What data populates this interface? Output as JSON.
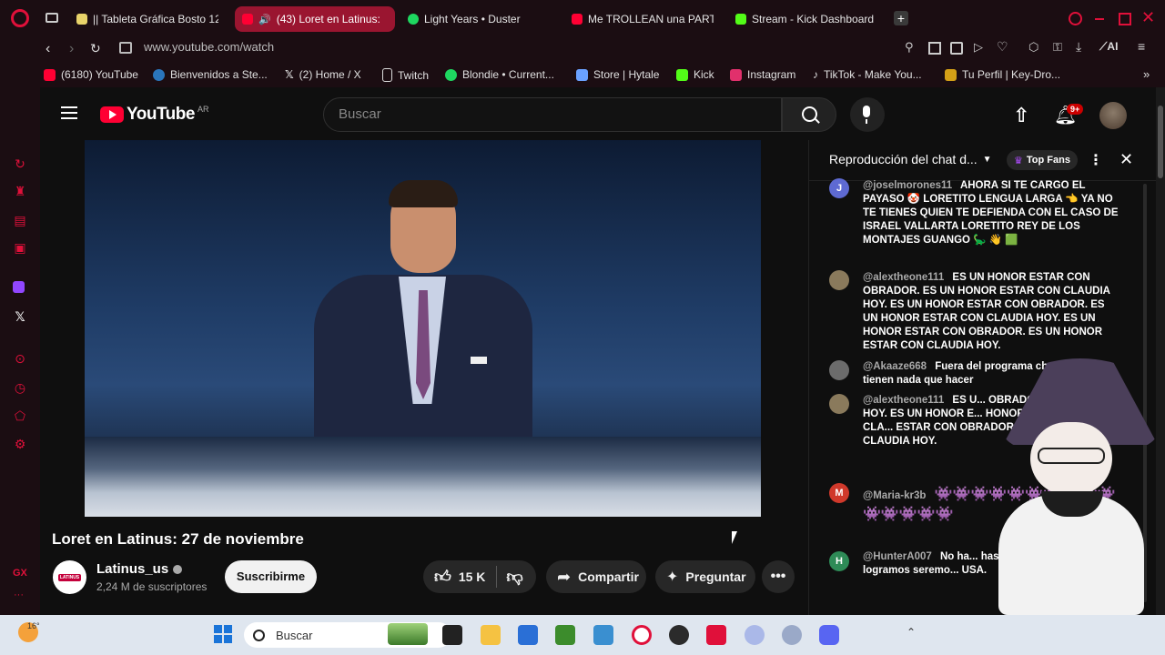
{
  "browser": {
    "tabs": [
      {
        "label": "|| Tableta Gráfica Bosto 12",
        "active": false,
        "color": "#e8d36a"
      },
      {
        "label": "(43) Loret en Latinus:",
        "active": true,
        "color": "#ff0033"
      },
      {
        "label": "Light Years • Duster",
        "active": false,
        "color": "#1ed760"
      },
      {
        "label": "Me TROLLEAN una PARTI",
        "active": false,
        "color": "#ff0033"
      },
      {
        "label": "Stream - Kick Dashboard",
        "active": false,
        "color": "#53fc18"
      }
    ],
    "url": "www.youtube.com/watch",
    "ai_label": "AI",
    "bookmarks": [
      {
        "label": "(6180) YouTube",
        "color": "#ff0033"
      },
      {
        "label": "Bienvenidos a Ste...",
        "color": "#2a75bb"
      },
      {
        "label": "(2) Home / X",
        "color": "#ffffff"
      },
      {
        "label": "Twitch",
        "color": "#ffffff"
      },
      {
        "label": "Blondie • Current...",
        "color": "#1ed760"
      },
      {
        "label": "Store | Hytale",
        "color": "#6aa1ff"
      },
      {
        "label": "Kick",
        "color": "#53fc18"
      },
      {
        "label": "Instagram",
        "color": "#e1306c"
      },
      {
        "label": "TikTok - Make You...",
        "color": "#ffffff"
      },
      {
        "label": "Tu Perfil | Key-Dro...",
        "color": "#d4a017"
      }
    ],
    "sidebar_gx": "GX"
  },
  "youtube": {
    "logo": "YouTube",
    "region": "AR",
    "search_placeholder": "Buscar",
    "notifications": "9+",
    "video_title": "Loret en Latinus: 27 de noviembre",
    "channel": {
      "name": "Latinus_us",
      "avatar_text": "LATINUS",
      "subscribers": "2,24 M de suscriptores"
    },
    "actions": {
      "subscribe": "Suscribirme",
      "likes": "15 K",
      "share": "Compartir",
      "ask": "Preguntar"
    },
    "chat": {
      "title": "Reproducción del chat d...",
      "top_fans": "Top Fans",
      "messages": [
        {
          "initial": "J",
          "color": "#5e6ad2",
          "author": "@joselmorones11",
          "text": "AHORA SI TE CARGO EL PAYASO 🤡 LORETITO LENGUA LARGA 👈 YA NO TE TIENES QUIEN TE DEFIENDA CON EL CASO DE ISRAEL VALLARTA LORETITO REY DE LOS MONTAJES GUANGO 🦕 👋 🟩"
        },
        {
          "initial": "",
          "color": "#8a7a5c",
          "author": "@alextheone111",
          "text": "ES UN HONOR ESTAR CON OBRADOR. ES UN HONOR ESTAR CON CLAUDIA HOY. ES UN HONOR ESTAR CON OBRADOR. ES UN HONOR ESTAR CON CLAUDIA HOY. ES UN HONOR ESTAR CON OBRADOR. ES UN HONOR ESTAR CON CLAUDIA HOY."
        },
        {
          "initial": "",
          "color": "#6c6c6c",
          "author": "@Akaaze668",
          "text": "Fuera del programa ch... quí no tienen nada que hacer"
        },
        {
          "initial": "",
          "color": "#8a7a5c",
          "author": "@alextheone111",
          "text": "ES U... OBRADOR. ES UN HO... HOY. ES UN HONOR E... HONOR ESTAR CON CLA... ESTAR CON OBRADOR. ES U... CON CLAUDIA HOY."
        },
        {
          "initial": "M",
          "color": "#d0392b",
          "author": "@Maria-kr3b",
          "text": "👾👾👾👾👾👾👾👾👾👾👾👾👾👾👾"
        },
        {
          "initial": "H",
          "color": "#2e8b57",
          "author": "@HunterA007",
          "text": "No ha... hasta que caiga est... logramos seremo... USA."
        }
      ]
    }
  },
  "taskbar": {
    "weather": "16°",
    "search": "Buscar"
  }
}
